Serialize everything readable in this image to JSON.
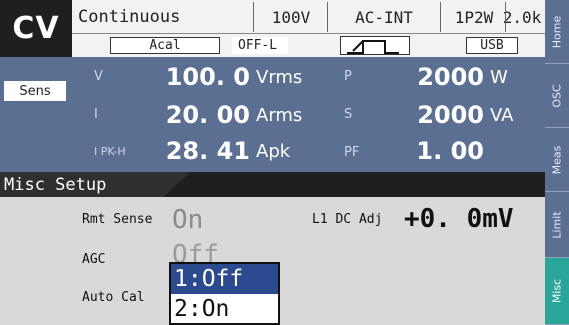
{
  "status_bar": {
    "mode": "CV",
    "sequence": "Continuous",
    "range": "100V",
    "source": "AC-INT",
    "wiring": "1P2W",
    "freq_range": "2.0k",
    "acal": "Acal",
    "output": "OFF-L",
    "interface": "USB",
    "waveform_icon": "square-wave-icon"
  },
  "measurement": {
    "sens_button": "Sens",
    "rows": [
      {
        "left_label": "V",
        "left_value": "100. 0",
        "left_unit": "Vrms",
        "right_label": "P",
        "right_value": "2000",
        "right_unit": "W"
      },
      {
        "left_label": "I",
        "left_value": "20. 00",
        "left_unit": "Arms",
        "right_label": "S",
        "right_value": "2000",
        "right_unit": "VA"
      },
      {
        "left_label": "I PK-H",
        "left_value": "28. 41",
        "left_unit": "Apk",
        "right_label": "PF",
        "right_value": "1. 00",
        "right_unit": ""
      }
    ]
  },
  "misc_setup": {
    "title": "Misc Setup",
    "rmt_sense_label": "Rmt Sense",
    "rmt_sense_value": "On",
    "l1_dc_adj_label": "L1 DC Adj",
    "l1_dc_adj_value": "+0. 0mV",
    "agc_label": "AGC",
    "agc_value": "Off",
    "auto_cal_label": "Auto Cal"
  },
  "dropdown": {
    "options": [
      "1:Off",
      "2:On"
    ],
    "selected_index": 0
  },
  "side_tabs": [
    "Home",
    "OSC",
    "Meas",
    "Limit",
    "Misc"
  ],
  "active_tab": "Misc",
  "colors": {
    "panel_blue": "#5b6f93",
    "selection_blue": "#2b4a8f",
    "active_tab_teal": "#2aa59a",
    "background_gray": "#d9d9d9"
  }
}
